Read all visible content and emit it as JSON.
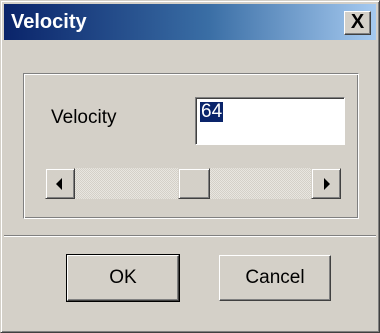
{
  "window": {
    "title": "Velocity",
    "close_glyph": "X"
  },
  "velocity": {
    "label": "Velocity",
    "value": "64",
    "slider": {
      "min": 0,
      "max": 127,
      "value": 64
    }
  },
  "buttons": {
    "ok_label": "OK",
    "cancel_label": "Cancel"
  },
  "icons": {
    "close": "close-icon",
    "scroll_left": "arrow-left-icon",
    "scroll_right": "arrow-right-icon"
  },
  "colors": {
    "titlebar_start": "#0a246a",
    "titlebar_end": "#a6caf0",
    "face": "#d4d0c8",
    "selection": "#0a246a"
  }
}
